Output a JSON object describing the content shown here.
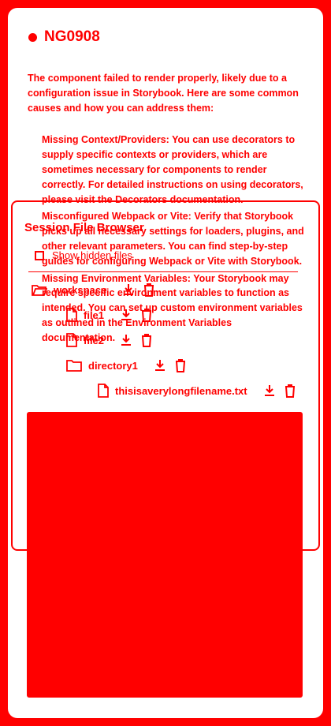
{
  "error": {
    "code": "NG0908",
    "intro": "The component failed to render properly, likely due to a configuration issue in Storybook. Here are some common causes and how you can address them:",
    "causes": [
      {
        "heading": "Missing Context/Providers:",
        "text": "You can use decorators to supply specific contexts or providers, which are sometimes necessary for components to render correctly. For detailed instructions on using decorators, please visit the Decorators documentation."
      },
      {
        "heading": "Misconfigured Webpack or Vite:",
        "text": "Verify that Storybook picks up all necessary settings for loaders, plugins, and other relevant parameters. You can find step-by-step guides for configuring Webpack or Vite with Storybook."
      },
      {
        "heading": "Missing Environment Variables:",
        "text": "Your Storybook may require specific environment variables to function as intended. You can set up custom environment variables as outlined in the Environment Variables documentation."
      }
    ]
  },
  "file_browser": {
    "title": "Session File Browser",
    "show_hidden_label": "Show hidden files",
    "tree": [
      {
        "name": "workspace",
        "type": "folder",
        "icon": "folder-open-icon"
      },
      {
        "name": "file1",
        "type": "file",
        "icon": "file-icon"
      },
      {
        "name": "file2",
        "type": "file",
        "icon": "file-icon"
      },
      {
        "name": "directory1",
        "type": "folder",
        "icon": "folder-icon"
      },
      {
        "name": "thisisaverylongfilename.txt",
        "type": "file",
        "icon": "file-icon"
      }
    ],
    "action_icons": [
      "download-icon",
      "trash-icon"
    ]
  },
  "colors": {
    "accent": "#ff0000",
    "background": "#ffffff"
  }
}
